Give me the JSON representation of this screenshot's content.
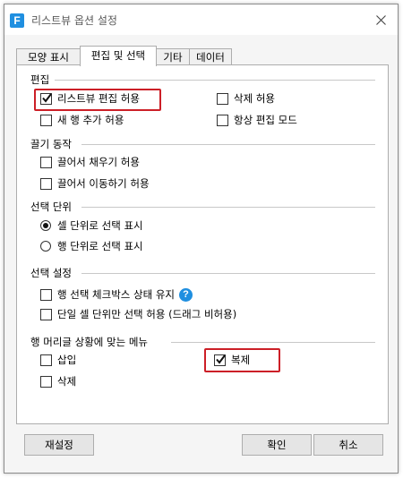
{
  "dialog": {
    "title": "리스트뷰 옵션 설정",
    "app_icon_letter": "F"
  },
  "tabs": [
    "모양 표시",
    "편집 및 선택",
    "기타",
    "데이터"
  ],
  "groups": {
    "edit": {
      "title": "편집",
      "options": [
        {
          "label": "리스트뷰 편집 허용",
          "checked": true
        },
        {
          "label": "새 행 추가 허용",
          "checked": false
        },
        {
          "label": "삭제 허용",
          "checked": false
        },
        {
          "label": "항상 편집 모드",
          "checked": false
        }
      ]
    },
    "drag": {
      "title": "끌기 동작",
      "options": [
        {
          "label": "끌어서 채우기 허용",
          "checked": false
        },
        {
          "label": "끌어서 이동하기 허용",
          "checked": false
        }
      ]
    },
    "selection_unit": {
      "title": "선택 단위",
      "options": [
        {
          "label": "셀 단위로 선택 표시",
          "selected": true
        },
        {
          "label": "행 단위로 선택 표시",
          "selected": false
        }
      ]
    },
    "selection_settings": {
      "title": "선택 설정",
      "options": [
        {
          "label": "행 선택 체크박스 상태 유지",
          "checked": false
        },
        {
          "label": "단일 셀 단위만 선택 허용 (드래그 비허용)",
          "checked": false
        }
      ]
    },
    "row_header_menu": {
      "title": "행 머리글 상황에 맞는 메뉴",
      "options": [
        {
          "label": "삽입",
          "checked": false
        },
        {
          "label": "삭제",
          "checked": false
        },
        {
          "label": "복제",
          "checked": true
        }
      ]
    }
  },
  "icons": {
    "help": "?"
  },
  "buttons": {
    "reset": "재설정",
    "ok": "확인",
    "cancel": "취소"
  },
  "colors": {
    "highlight": "#cc1f27",
    "accent": "#1f8fe0"
  }
}
